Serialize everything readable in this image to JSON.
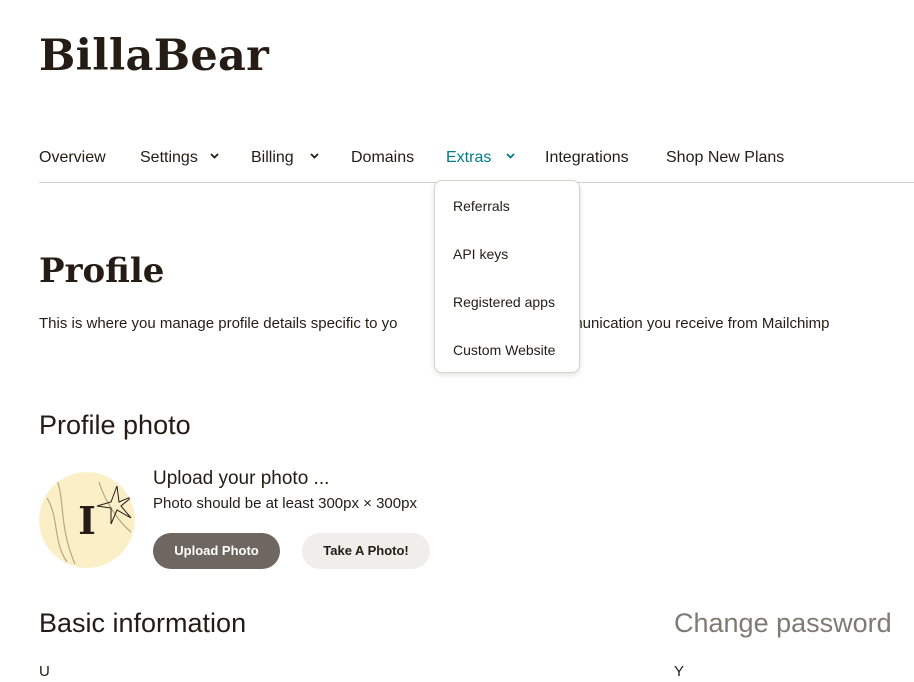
{
  "brand": {
    "name": "BillaBear"
  },
  "nav": {
    "items": [
      {
        "label": "Overview",
        "has_menu": false
      },
      {
        "label": "Settings",
        "has_menu": true
      },
      {
        "label": "Billing",
        "has_menu": true
      },
      {
        "label": "Domains",
        "has_menu": false
      },
      {
        "label": "Extras",
        "has_menu": true,
        "active": true
      },
      {
        "label": "Integrations",
        "has_menu": false
      },
      {
        "label": "Shop New Plans",
        "has_menu": false
      }
    ],
    "active_color": "#007c89"
  },
  "extras_menu": {
    "items": [
      {
        "label": "Referrals"
      },
      {
        "label": "API keys"
      },
      {
        "label": "Registered apps"
      },
      {
        "label": "Custom Website"
      }
    ]
  },
  "profile": {
    "title": "Profile",
    "intro_left": "This is where you manage profile details specific to yo",
    "intro_right": "t communication you receive from Mailchimp"
  },
  "profile_photo": {
    "heading": "Profile photo",
    "avatar_letter": "I",
    "upload_title": "Upload your photo ...",
    "upload_hint": "Photo should be at least 300px × 300px",
    "upload_button": "Upload Photo",
    "take_photo_button": "Take A Photo!"
  },
  "basic_info": {
    "heading": "Basic information",
    "partial_label": "U"
  },
  "change_password": {
    "heading": "Change password",
    "partial_text": "Y"
  },
  "colors": {
    "text": "#241c15",
    "primary_button": "#6e6761",
    "secondary_button": "#efeeea",
    "avatar_bg": "#fbefc8"
  }
}
